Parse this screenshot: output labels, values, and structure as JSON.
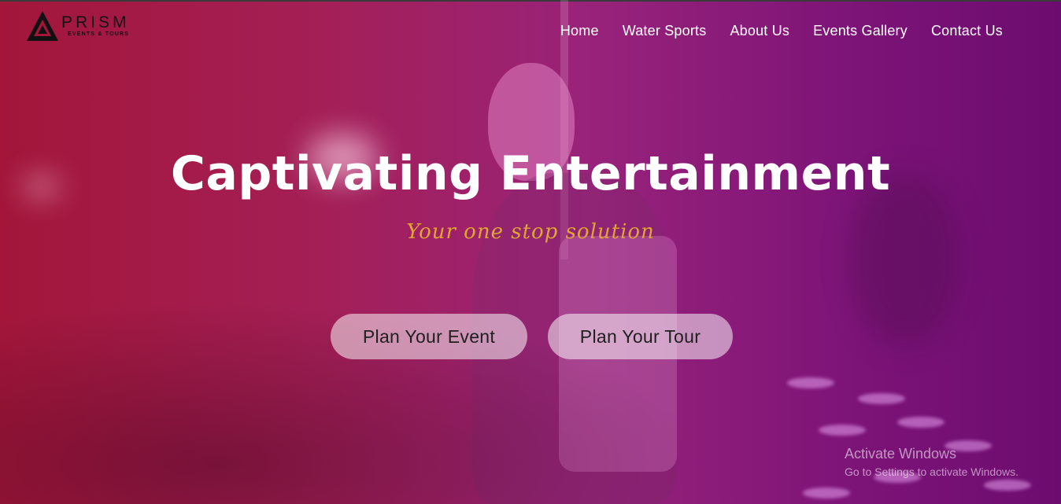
{
  "brand": {
    "name": "PRISM",
    "subtitle": "EVENTS & TOURS"
  },
  "nav": {
    "items": [
      {
        "label": "Home"
      },
      {
        "label": "Water Sports"
      },
      {
        "label": "About Us"
      },
      {
        "label": "Events Gallery"
      },
      {
        "label": "Contact Us"
      }
    ]
  },
  "hero": {
    "headline": "Captivating Entertainment",
    "tagline": "Your one stop solution",
    "buttons": {
      "event": "Plan Your Event",
      "tour": "Plan Your Tour"
    }
  },
  "watermark": {
    "title": "Activate Windows",
    "subtitle": "Go to Settings to activate Windows."
  },
  "colors": {
    "gradient_left": "#a3163a",
    "gradient_right": "#6d0c70",
    "tagline": "#e0a531",
    "text": "#ffffff"
  },
  "icons": {
    "logo": "prism-triangle-logo-icon"
  }
}
